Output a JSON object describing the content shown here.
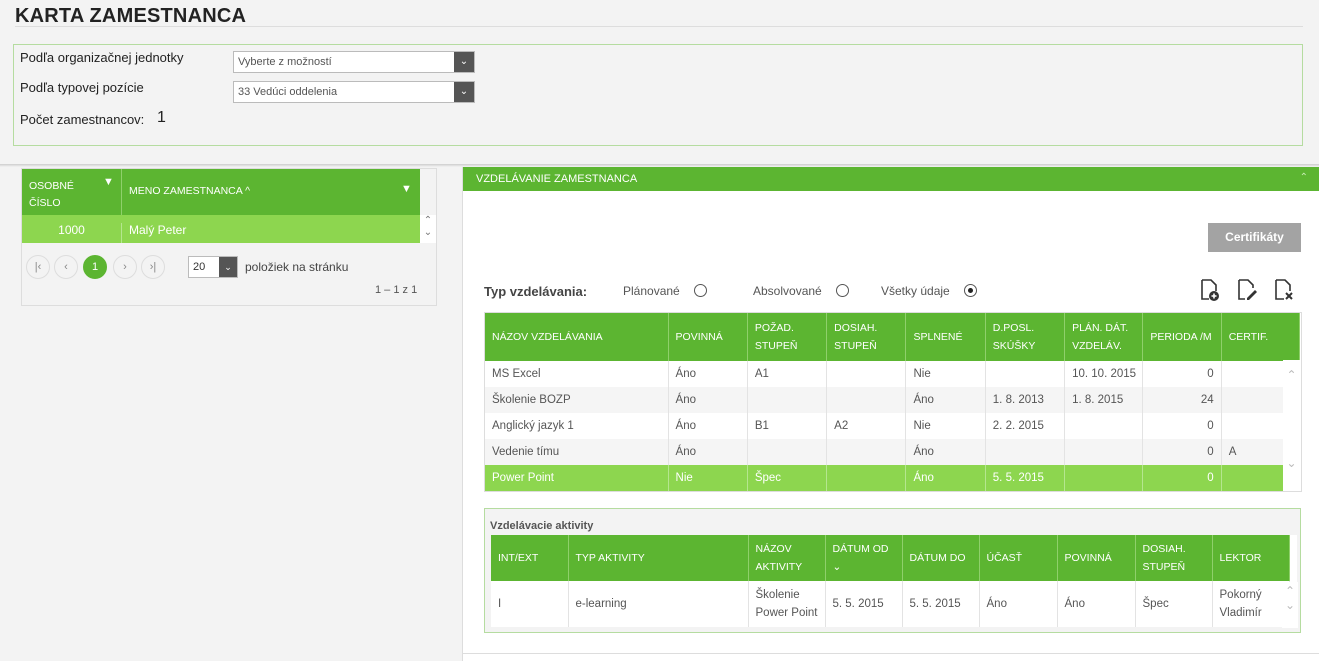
{
  "page_title": "KARTA ZAMESTNANCA",
  "filters": {
    "org_unit_label": "Podľa organizačnej jednotky",
    "org_unit_value": "Vyberte z možností",
    "position_label": "Podľa typovej pozície",
    "position_value": "33 Vedúci oddelenia",
    "count_label": "Počet zamestnancov:",
    "count_value": "1"
  },
  "employee_grid": {
    "col_id": "OSOBNÉ ČÍSLO",
    "col_name": "MENO ZAMESTNANCA",
    "rows": [
      {
        "id": "1000",
        "name": "Malý Peter"
      }
    ],
    "pager": {
      "current": "1",
      "page_size": "20",
      "page_size_label": "položiek na stránku",
      "range": "1 – 1 z 1"
    }
  },
  "education_panel": {
    "title": "VZDELÁVANIE ZAMESTNANCA",
    "cert_button": "Certifikáty",
    "type_label": "Typ vzdelávania:",
    "options": [
      "Plánované",
      "Absolvované",
      "Všetky údaje"
    ],
    "selected_option": "Všetky údaje",
    "columns": [
      "NÁZOV VZDELÁVANIA",
      "POVINNÁ",
      "POŽAD. STUPEŇ",
      "DOSIAH. STUPEŇ",
      "SPLNENÉ",
      "D.POSL. SKÚŠKY",
      "PLÁN. DÁT. VZDELÁV.",
      "PERIODA /M",
      "CERTIF."
    ],
    "rows": [
      [
        "MS Excel",
        "Áno",
        "A1",
        "",
        "Nie",
        "",
        "10. 10. 2015",
        "0",
        ""
      ],
      [
        "Školenie BOZP",
        "Áno",
        "",
        "",
        "Áno",
        "1. 8. 2013",
        "1. 8. 2015",
        "24",
        ""
      ],
      [
        "Anglický jazyk 1",
        "Áno",
        "B1",
        "A2",
        "Nie",
        "2. 2. 2015",
        "",
        "0",
        ""
      ],
      [
        "Vedenie tímu",
        "Áno",
        "",
        "",
        "Áno",
        "",
        "",
        "0",
        "A"
      ],
      [
        "Power Point",
        "Nie",
        "Špec",
        "",
        "Áno",
        "5. 5. 2015",
        "",
        "0",
        ""
      ]
    ],
    "selected_row": 4
  },
  "activities": {
    "title": "Vzdelávacie aktivity",
    "columns": [
      "INT/EXT",
      "TYP AKTIVITY",
      "NÁZOV AKTIVITY",
      "DÁTUM OD",
      "DÁTUM DO",
      "ÚČASŤ",
      "POVINNÁ",
      "DOSIAH. STUPEŇ",
      "LEKTOR"
    ],
    "rows": [
      [
        "I",
        "e-learning",
        "Školenie Power Point",
        "5. 5. 2015",
        "5. 5. 2015",
        "Áno",
        "Áno",
        "Špec",
        "Pokorný Vladimír"
      ]
    ]
  },
  "colors": {
    "accent": "#5cb531",
    "selected_row": "#8dd64f",
    "button_gray": "#a3a3a3"
  }
}
